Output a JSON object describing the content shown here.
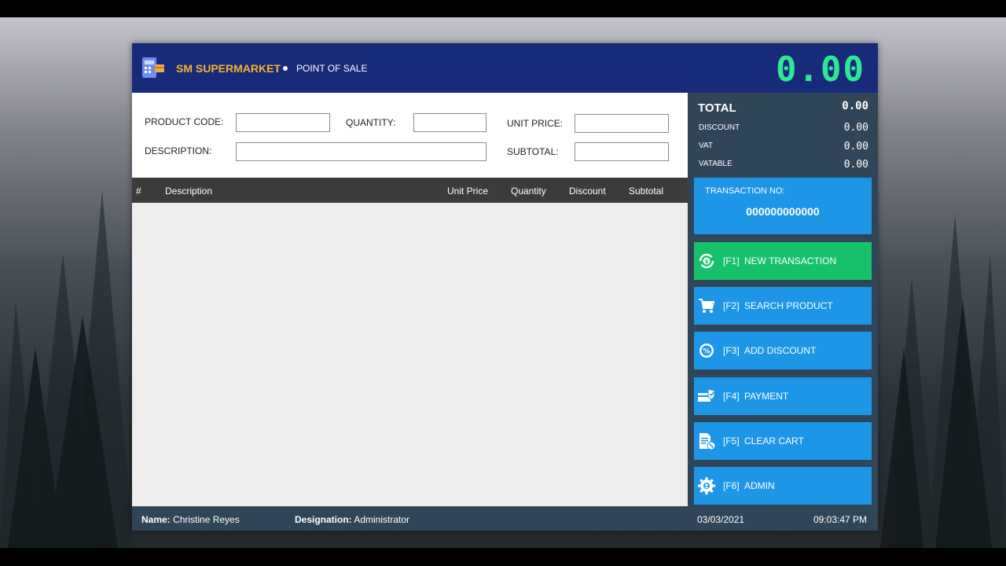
{
  "header": {
    "store_name": "SM SUPERMARKET",
    "subtitle": "POINT OF SALE",
    "grand_total": "0.00"
  },
  "form": {
    "product_code_label": "PRODUCT CODE:",
    "quantity_label": "QUANTITY:",
    "unit_price_label": "UNIT PRICE:",
    "description_label": "DESCRIPTION:",
    "subtotal_label": "SUBTOTAL:",
    "product_code_value": "",
    "quantity_value": "",
    "unit_price_value": "",
    "description_value": "",
    "subtotal_value": ""
  },
  "table": {
    "columns": [
      "#",
      "Description",
      "Unit Price",
      "Quantity",
      "Discount",
      "Subtotal"
    ],
    "rows": []
  },
  "summary": {
    "total_label": "TOTAL",
    "total_value": "0.00",
    "discount_label": "DISCOUNT",
    "discount_value": "0.00",
    "vat_label": "VAT",
    "vat_value": "0.00",
    "vatable_label": "VATABLE",
    "vatable_value": "0.00"
  },
  "transaction": {
    "label": "TRANSACTION NO:",
    "number": "000000000000"
  },
  "actions": [
    {
      "key": "[F1]",
      "label": "NEW TRANSACTION",
      "icon": "cycle-icon",
      "color": "#17c16c"
    },
    {
      "key": "[F2]",
      "label": "SEARCH PRODUCT",
      "icon": "cart-icon",
      "color": "#1e96e8"
    },
    {
      "key": "[F3]",
      "label": "ADD DISCOUNT",
      "icon": "discount-gear-icon",
      "color": "#1e96e8"
    },
    {
      "key": "[F4]",
      "label": "PAYMENT",
      "icon": "payment-card-icon",
      "color": "#1e96e8"
    },
    {
      "key": "[F5]",
      "label": "CLEAR CART",
      "icon": "clear-document-icon",
      "color": "#1e96e8"
    },
    {
      "key": "[F6]",
      "label": "ADMIN",
      "icon": "admin-gear-icon",
      "color": "#1e96e8"
    }
  ],
  "footer": {
    "name_label": "Name:",
    "name_value": "Christine Reyes",
    "designation_label": "Designation:",
    "designation_value": "Administrator",
    "date": "03/03/2021",
    "time": "09:03:47 PM"
  },
  "colors": {
    "header_bg": "#182a7a",
    "brand": "#f2b42d",
    "total_digits": "#2ee893",
    "panel_bg": "#314559",
    "button_blue": "#1e96e8",
    "button_green": "#17c16c"
  }
}
